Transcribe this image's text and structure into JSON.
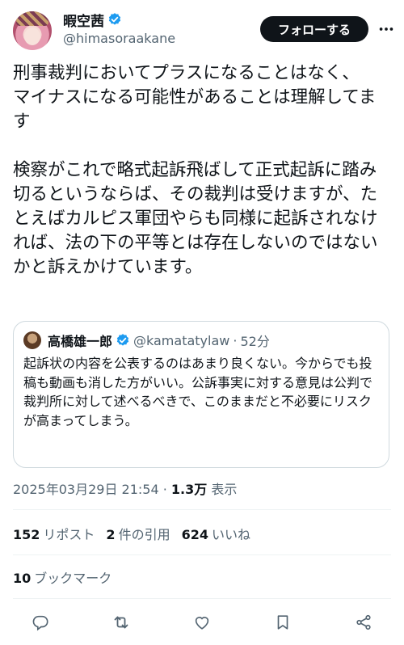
{
  "author": {
    "display_name": "暇空茜",
    "handle": "@himasoraakane",
    "follow_label": "フォローする"
  },
  "tweet": {
    "text": "刑事裁判においてプラスになることはなく、\nマイナスになる可能性があることは理解してます\n\n検察がこれで略式起訴飛ばして正式起訴に踏み切るというならば、その裁判は受けますが、たとえばカルピス軍団やらも同様に起訴されなければ、法の下の平等とは存在しないのではないかと訴えかけています。"
  },
  "quoted": {
    "display_name": "高橋雄一郎",
    "handle": "@kamatatylaw",
    "separator": "·",
    "time": "52分",
    "text": "起訴状の内容を公表するのはあまり良くない。今からでも投稿も動画も消した方がいい。公訴事実に対する意見は公判で裁判所に対して述べるべきで、このままだと不必要にリスクが高まってしまう。"
  },
  "meta": {
    "timestamp": "2025年03月29日 21:54",
    "dot": "·",
    "views": "1.3万",
    "views_label": "表示"
  },
  "stats": {
    "reposts_num": "152",
    "reposts_label": "リポスト",
    "quotes_num": "2",
    "quotes_label": "件の引用",
    "likes_num": "624",
    "likes_label": "いいね",
    "bookmarks_num": "10",
    "bookmarks_label": "ブックマーク"
  },
  "icons": {
    "verified": "verified-badge-icon",
    "more": "more-icon",
    "reply": "reply-icon",
    "repost": "repost-icon",
    "like": "like-icon",
    "bookmark": "bookmark-icon",
    "share": "share-icon"
  },
  "colors": {
    "verified": "#1d9bf0",
    "text": "#0f1419",
    "secondary": "#536471",
    "border": "#cfd9de"
  }
}
